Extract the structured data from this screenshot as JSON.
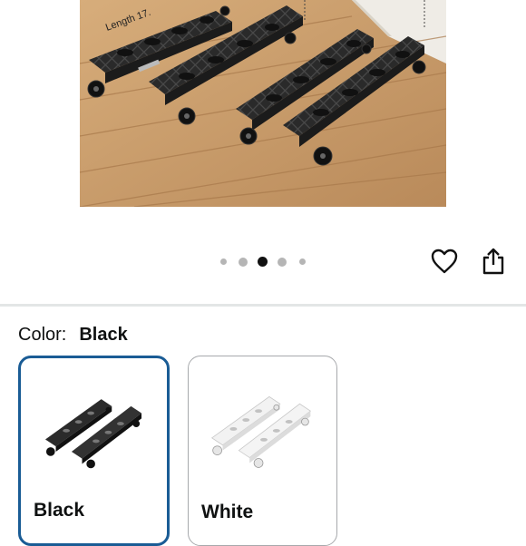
{
  "gallery": {
    "image_alt": "Adjustable rolling stands with wheels on wooden floor",
    "overlay_text": "Length 17.",
    "dot_count": 5,
    "active_index": 2
  },
  "actions": {
    "favorite_icon": "heart-icon",
    "share_icon": "share-icon"
  },
  "color_selector": {
    "label": "Color:",
    "selected_value": "Black",
    "options": [
      {
        "name": "Black",
        "selected": true
      },
      {
        "name": "White",
        "selected": false
      }
    ]
  },
  "colors": {
    "selected_border": "#1a5c95",
    "dot_active": "#111111",
    "dot_inactive": "#b5b5b5"
  }
}
